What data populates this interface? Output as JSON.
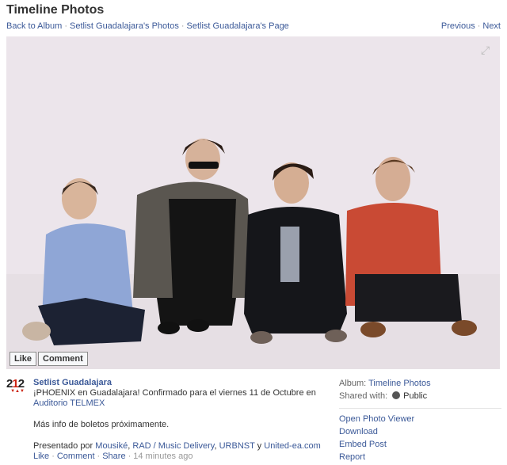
{
  "header": {
    "title": "Timeline Photos",
    "breadcrumbs": [
      "Back to Album",
      "Setlist Guadalajara's Photos",
      "Setlist Guadalajara's Page"
    ],
    "previous": "Previous",
    "next": "Next"
  },
  "photo": {
    "like_button": "Like",
    "comment_button": "Comment",
    "expand_icon": "expand-icon"
  },
  "avatar": {
    "number": "212"
  },
  "post": {
    "author": "Setlist Guadalajara",
    "line1": "¡PHOENIX en Guadalajara! Confirmado para el viernes 11 de Octubre en ",
    "venue_link": "Auditorio TELMEX",
    "line2": "Más info de boletos próximamente.",
    "presented_prefix": "Presentado por ",
    "sponsors": [
      "Mousiké",
      "RAD / Music Delivery",
      "URBNST"
    ],
    "sponsor_and": " y ",
    "sponsor_last": "United-ea.com",
    "actions": [
      "Like",
      "Comment",
      "Share"
    ],
    "timestamp": "14 minutes ago"
  },
  "sidebar": {
    "album_label": "Album:",
    "album_value": "Timeline Photos",
    "shared_label": "Shared with:",
    "shared_value": "Public",
    "links": [
      "Open Photo Viewer",
      "Download",
      "Embed Post",
      "Report"
    ]
  },
  "colors": {
    "link": "#3b5998",
    "photo_bg": "#ebe4ea"
  }
}
